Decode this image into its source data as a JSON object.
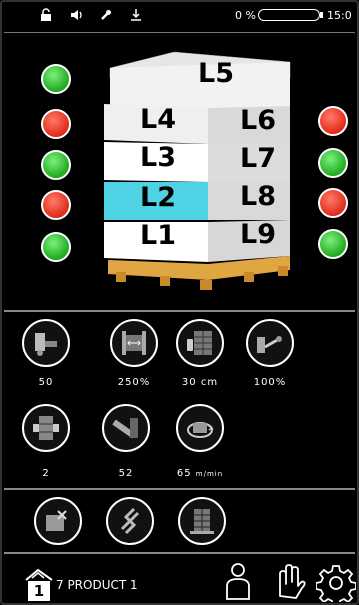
{
  "status_bar": {
    "icons": [
      "lock-open-icon",
      "volume-icon",
      "wrench-icon",
      "download-icon"
    ],
    "battery_percent": "0 %",
    "battery_level": 0.0,
    "time": "15:0"
  },
  "pallet": {
    "layers_front": [
      "L1",
      "L2",
      "L3",
      "L4",
      "L5"
    ],
    "layers_side": [
      "L9",
      "L8",
      "L7",
      "L6"
    ],
    "highlight_layer": "L2",
    "highlight_color": "#4fd2e3"
  },
  "indicators": {
    "left": [
      "green",
      "red",
      "green",
      "red",
      "green"
    ],
    "right": [
      "red",
      "green",
      "red",
      "green"
    ]
  },
  "parameters": [
    {
      "icon": "prestretch-roller-icon",
      "value": "50"
    },
    {
      "icon": "film-width-icon",
      "value": "250%"
    },
    {
      "icon": "remote-control-icon",
      "value": "30 cm"
    },
    {
      "icon": "film-cutter-icon",
      "value": "100%"
    },
    {
      "icon": "overlap-icon",
      "value": "2"
    },
    {
      "icon": "film-roll-icon",
      "value": "52"
    },
    {
      "icon": "rotation-speed-icon",
      "value": "65",
      "unit": "m/min"
    }
  ],
  "extra_buttons": [
    "film-tool-icon",
    "reinforce-icon",
    "pallet-grid-icon"
  ],
  "bottom_bar": {
    "product_number": "1",
    "product_name": "7 PRODUCT 1",
    "icons": [
      "operator-icon",
      "hand-icon",
      "settings-icon"
    ]
  },
  "colors": {
    "green": "#1faa1f",
    "red": "#e02b1a",
    "accent": "#4fd2e3",
    "pallet_base": "#e0a642"
  }
}
